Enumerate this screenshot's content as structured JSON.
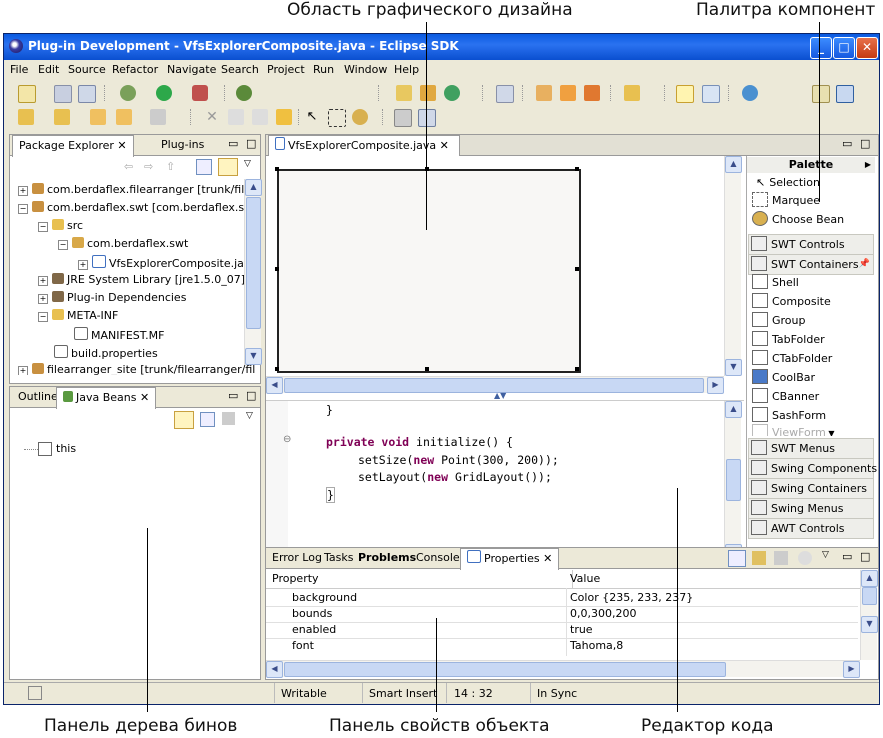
{
  "annotations": {
    "design_area": "Область графического дизайна",
    "palette": "Палитра компонент",
    "bean_tree": "Панель дерева бинов",
    "properties": "Панель свойств объекта",
    "code_editor": "Редактор кода"
  },
  "window": {
    "title": "Plug-in Development - VfsExplorerComposite.java - Eclipse SDK",
    "buttons": [
      "_",
      "□",
      "✕"
    ]
  },
  "menu": [
    "File",
    "Edit",
    "Source",
    "Refactor",
    "Navigate",
    "Search",
    "Project",
    "Run",
    "Window",
    "Help"
  ],
  "package_explorer": {
    "tabs": [
      "Package Explorer",
      "Plug-ins"
    ],
    "items": [
      "com.berdaflex.filearranger [trunk/filea",
      "com.berdaflex.swt [com.berdaflex.swt",
      "src",
      "com.berdaflex.swt",
      "VfsExplorerComposite.java",
      "JRE System Library [jre1.5.0_07]",
      "Plug-in Dependencies",
      "META-INF",
      "MANIFEST.MF",
      "build.properties",
      "filearranger_site [trunk/filearranger/fil"
    ]
  },
  "beans": {
    "tabs": [
      "Outline",
      "Java Beans"
    ],
    "items": [
      "this"
    ]
  },
  "editor": {
    "tab": "VfsExplorerComposite.java",
    "code": [
      "}",
      "private void initialize() {",
      "setSize(new Point(300, 200));",
      "setLayout(new GridLayout());",
      "}"
    ],
    "code_parts": {
      "private": "private",
      "void": "void",
      "initialize": " initialize() {",
      "setsize": "setSize(",
      "new1": "new",
      "point": " Point(300, 200));",
      "setlayout": "setLayout(",
      "new2": "new",
      "grid": " GridLayout());"
    }
  },
  "palette": {
    "title": "Palette",
    "tools": [
      "Selection",
      "Marquee",
      "Choose Bean"
    ],
    "categories_top": [
      "SWT Controls",
      "SWT Containers"
    ],
    "containers": [
      "Shell",
      "Composite",
      "Group",
      "TabFolder",
      "CTabFolder",
      "CoolBar",
      "CBanner",
      "SashForm",
      "ViewForm"
    ],
    "categories_bottom": [
      "SWT Menus",
      "Swing Components",
      "Swing Containers",
      "Swing Menus",
      "AWT Controls"
    ]
  },
  "bottom_panel": {
    "tabs": [
      "Error Log",
      "Tasks",
      "Problems",
      "Console",
      "Properties"
    ],
    "columns": [
      "Property",
      "Value"
    ],
    "rows": [
      {
        "property": "background",
        "value": "Color {235, 233, 237}"
      },
      {
        "property": "bounds",
        "value": "0,0,300,200"
      },
      {
        "property": "enabled",
        "value": "true"
      },
      {
        "property": "font",
        "value": "Tahoma,8"
      }
    ]
  },
  "status": {
    "writable": "Writable",
    "insert": "Smart Insert",
    "position": "14 : 32",
    "sync": "In Sync"
  },
  "colors": {
    "title_bar": "#0a5ae0",
    "keyword": "#7f0055",
    "chrome": "#ece9d8"
  }
}
